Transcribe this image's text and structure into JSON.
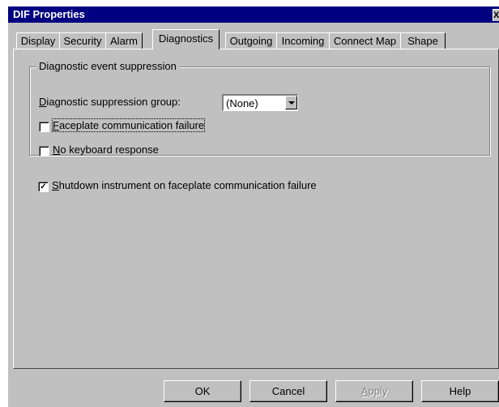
{
  "window": {
    "title": "DIF Properties",
    "close_glyph": "X"
  },
  "tabs": [
    {
      "label": "Display"
    },
    {
      "label": "Security"
    },
    {
      "label": "Alarm"
    },
    {
      "label": "Diagnostics",
      "active": true
    },
    {
      "label": "Outgoing"
    },
    {
      "label": "Incoming"
    },
    {
      "label": "Connect Map"
    },
    {
      "label": "Shape"
    }
  ],
  "group": {
    "legend": "Diagnostic event suppression",
    "suppression_group_label_mnemonic": "D",
    "suppression_group_label_rest": "iagnostic suppression group:",
    "suppression_group_value": "(None)",
    "faceplate_failure_mnemonic": "F",
    "faceplate_failure_rest": "aceplate communication failure",
    "faceplate_failure_checked": false,
    "no_keyboard_mnemonic": "N",
    "no_keyboard_rest": "o keyboard response",
    "no_keyboard_checked": false
  },
  "shutdown": {
    "mnemonic": "S",
    "rest": "hutdown instrument on faceplate communication failure",
    "checked": true,
    "check_glyph": "✓"
  },
  "buttons": {
    "ok": "OK",
    "cancel": "Cancel",
    "apply_mnemonic": "A",
    "apply_rest": "pply",
    "help": "Help"
  }
}
